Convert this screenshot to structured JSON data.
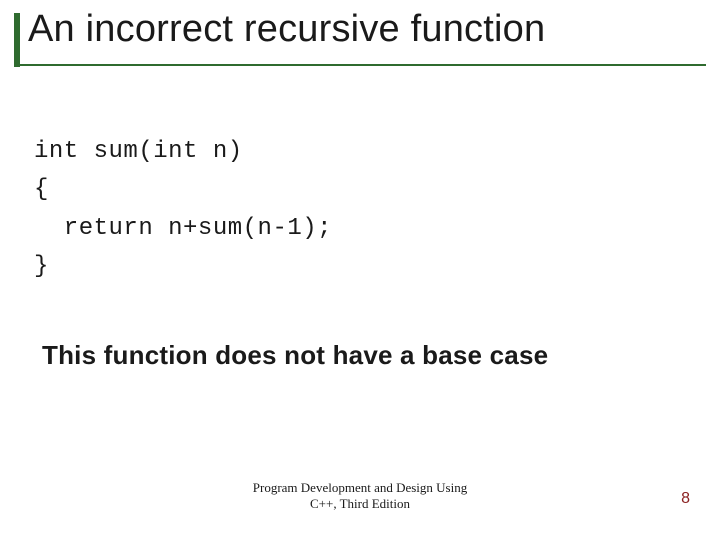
{
  "slide": {
    "title": "An incorrect recursive function",
    "code": {
      "line1": "int sum(int n)",
      "line2": "{",
      "line3": "  return n+sum(n-1);",
      "line4": "}"
    },
    "caption": "This function does not have a base case",
    "footer": {
      "line1": "Program Development and Design Using",
      "line2": "C++, Third Edition"
    },
    "page_number": "8"
  },
  "colors": {
    "accent": "#2f6b2f",
    "pagenum": "#8a1f1f"
  }
}
